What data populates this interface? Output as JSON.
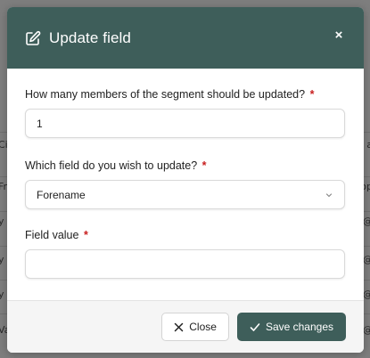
{
  "background": {
    "left_fragments": [
      "Ci",
      "Fre",
      "y",
      "y",
      "y",
      "Va"
    ],
    "right_fragments": [
      "a",
      "op",
      "@",
      "@",
      "@",
      "@"
    ]
  },
  "modal": {
    "title": "Update field",
    "header_icon": "edit-square-icon",
    "close_icon": "close-x-icon",
    "close_glyph": "×",
    "fields": {
      "members_count": {
        "label": "How many members of the segment should be updated?",
        "required_mark": "*",
        "value": "1"
      },
      "field_select": {
        "label": "Which field do you wish to update?",
        "required_mark": "*",
        "selected": "Forename"
      },
      "field_value": {
        "label": "Field value",
        "required_mark": "*",
        "value": ""
      }
    },
    "footer": {
      "close_label": "Close",
      "save_label": "Save changes"
    }
  },
  "colors": {
    "header": "#3e5e5a",
    "primary_button": "#3e5e5a",
    "required": "#c81e1e"
  }
}
